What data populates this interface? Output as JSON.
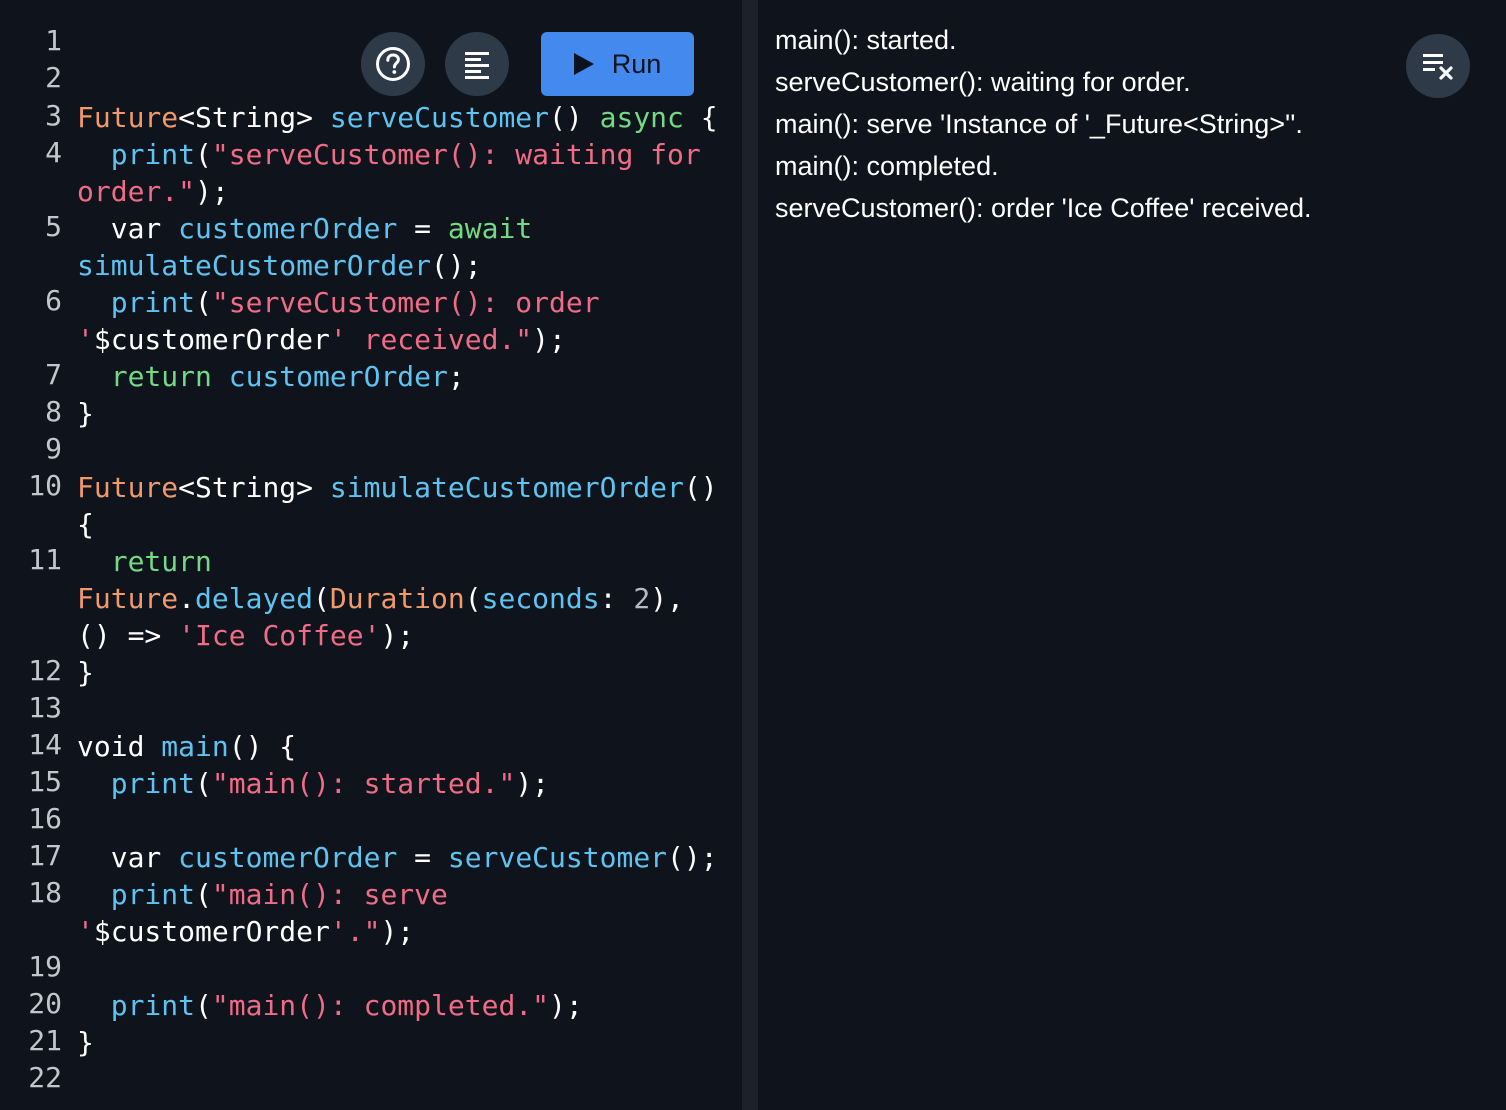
{
  "toolbar": {
    "help_icon": "help-circle-icon",
    "format_icon": "format-align-icon",
    "run_label": "Run",
    "clear_icon": "clear-output-icon"
  },
  "editor": {
    "line_numbers": [
      "1",
      "2",
      "3",
      "4",
      "5",
      "6",
      "7",
      "8",
      "9",
      "10",
      "11",
      "12",
      "13",
      "14",
      "15",
      "16",
      "17",
      "18",
      "19",
      "20",
      "21",
      "22"
    ],
    "rows": [
      [
        {
          "t": "Future",
          "c": "type"
        },
        {
          "t": "<String> ",
          "c": "plain"
        },
        {
          "t": "serveCustomer",
          "c": "fn"
        },
        {
          "t": "() ",
          "c": "plain"
        },
        {
          "t": "async",
          "c": "kw"
        },
        {
          "t": " {",
          "c": "plain"
        }
      ],
      [
        {
          "t": "  ",
          "c": "plain"
        },
        {
          "t": "print",
          "c": "fn"
        },
        {
          "t": "(",
          "c": "plain"
        },
        {
          "t": "\"serveCustomer(): waiting for",
          "c": "str"
        }
      ],
      [
        {
          "t": "order.\"",
          "c": "str"
        },
        {
          "t": ");",
          "c": "plain"
        }
      ],
      [
        {
          "t": "  var ",
          "c": "plain"
        },
        {
          "t": "customerOrder",
          "c": "fn"
        },
        {
          "t": " = ",
          "c": "plain"
        },
        {
          "t": "await",
          "c": "kw"
        }
      ],
      [
        {
          "t": "simulateCustomerOrder",
          "c": "fn"
        },
        {
          "t": "();",
          "c": "plain"
        }
      ],
      [
        {
          "t": "  ",
          "c": "plain"
        },
        {
          "t": "print",
          "c": "fn"
        },
        {
          "t": "(",
          "c": "plain"
        },
        {
          "t": "\"serveCustomer(): order",
          "c": "str"
        }
      ],
      [
        {
          "t": "'",
          "c": "str"
        },
        {
          "t": "$customerOrder",
          "c": "plain"
        },
        {
          "t": "' received.\"",
          "c": "str"
        },
        {
          "t": ");",
          "c": "plain"
        }
      ],
      [
        {
          "t": "  ",
          "c": "plain"
        },
        {
          "t": "return",
          "c": "kw"
        },
        {
          "t": " ",
          "c": "plain"
        },
        {
          "t": "customerOrder",
          "c": "fn"
        },
        {
          "t": ";",
          "c": "plain"
        }
      ],
      [
        {
          "t": "}",
          "c": "plain"
        }
      ],
      [
        {
          "t": "Future",
          "c": "type"
        },
        {
          "t": "<String> ",
          "c": "plain"
        },
        {
          "t": "simulateCustomerOrder",
          "c": "fn"
        },
        {
          "t": "()",
          "c": "plain"
        }
      ],
      [
        {
          "t": "{",
          "c": "plain"
        }
      ],
      [
        {
          "t": "  ",
          "c": "plain"
        },
        {
          "t": "return",
          "c": "kw"
        }
      ],
      [
        {
          "t": "Future",
          "c": "type"
        },
        {
          "t": ".",
          "c": "plain"
        },
        {
          "t": "delayed",
          "c": "fn"
        },
        {
          "t": "(",
          "c": "plain"
        },
        {
          "t": "Duration",
          "c": "type"
        },
        {
          "t": "(",
          "c": "plain"
        },
        {
          "t": "seconds",
          "c": "fn"
        },
        {
          "t": ": ",
          "c": "plain"
        },
        {
          "t": "2",
          "c": "num"
        },
        {
          "t": "),",
          "c": "plain"
        }
      ],
      [
        {
          "t": "() => ",
          "c": "plain"
        },
        {
          "t": "'Ice Coffee'",
          "c": "str"
        },
        {
          "t": ");",
          "c": "plain"
        }
      ],
      [
        {
          "t": "}",
          "c": "plain"
        }
      ],
      [
        {
          "t": "void ",
          "c": "plain"
        },
        {
          "t": "main",
          "c": "fn"
        },
        {
          "t": "() {",
          "c": "plain"
        }
      ],
      [
        {
          "t": "  ",
          "c": "plain"
        },
        {
          "t": "print",
          "c": "fn"
        },
        {
          "t": "(",
          "c": "plain"
        },
        {
          "t": "\"main(): started.\"",
          "c": "str"
        },
        {
          "t": ");",
          "c": "plain"
        }
      ],
      [
        {
          "t": "  var ",
          "c": "plain"
        },
        {
          "t": "customerOrder",
          "c": "fn"
        },
        {
          "t": " = ",
          "c": "plain"
        },
        {
          "t": "serveCustomer",
          "c": "fn"
        },
        {
          "t": "();",
          "c": "plain"
        }
      ],
      [
        {
          "t": "  ",
          "c": "plain"
        },
        {
          "t": "print",
          "c": "fn"
        },
        {
          "t": "(",
          "c": "plain"
        },
        {
          "t": "\"main(): serve",
          "c": "str"
        }
      ],
      [
        {
          "t": "'",
          "c": "str"
        },
        {
          "t": "$customerOrder",
          "c": "plain"
        },
        {
          "t": "'.\"",
          "c": "str"
        },
        {
          "t": ");",
          "c": "plain"
        }
      ],
      [
        {
          "t": "  ",
          "c": "plain"
        },
        {
          "t": "print",
          "c": "fn"
        },
        {
          "t": "(",
          "c": "plain"
        },
        {
          "t": "\"main(): completed.\"",
          "c": "str"
        },
        {
          "t": ");",
          "c": "plain"
        }
      ],
      [
        {
          "t": "}",
          "c": "plain"
        }
      ]
    ]
  },
  "output": {
    "lines": [
      "main(): started.",
      "serveCustomer(): waiting for order.",
      "main(): serve 'Instance of '_Future<String>''.",
      "main(): completed.",
      "serveCustomer(): order 'Ice Coffee' received."
    ]
  },
  "colors": {
    "background": "#0f141c",
    "run_button": "#4389ee",
    "icon_button": "#2f3a49",
    "type": "#f0996b",
    "function": "#5ec3f0",
    "keyword": "#73d985",
    "string": "#f06b86"
  }
}
